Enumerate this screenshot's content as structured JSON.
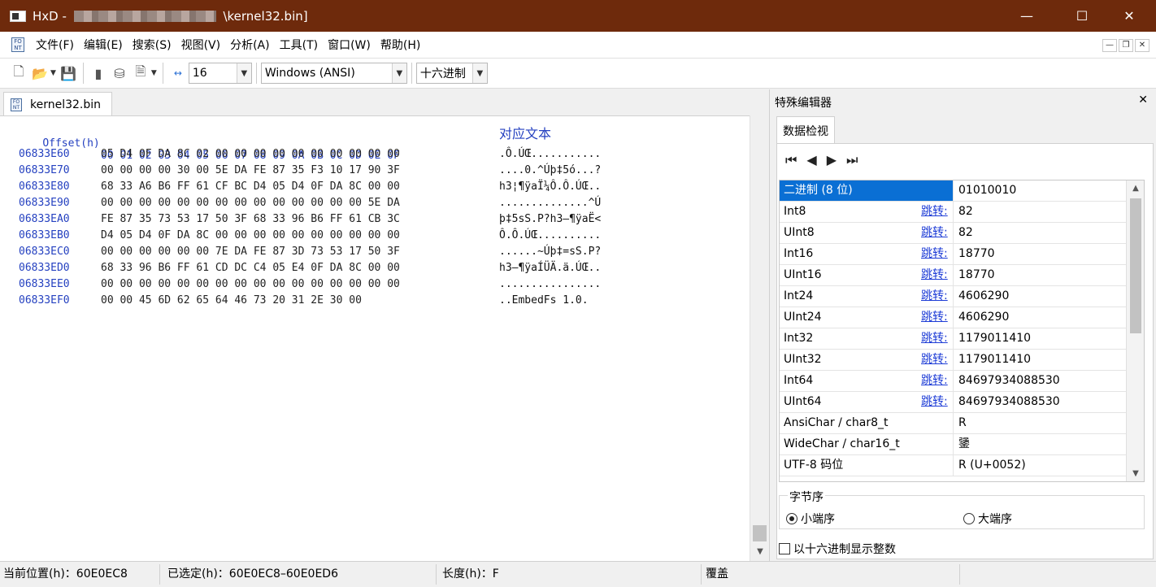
{
  "window": {
    "title_prefix": "HxD -",
    "title_suffix": "\\kernel32.bin]",
    "minimize": "—",
    "maximize": "☐",
    "close": "✕"
  },
  "menu": [
    "文件(F)",
    "编辑(E)",
    "搜索(S)",
    "视图(V)",
    "分析(A)",
    "工具(T)",
    "窗口(W)",
    "帮助(H)"
  ],
  "mdi": {
    "minimize": "—",
    "restore": "❐",
    "close": "✕"
  },
  "toolbar": {
    "bytes_per_row": "16",
    "charset": "Windows (ANSI)",
    "offset_base": "十六进制"
  },
  "editor_tab": {
    "label": "kernel32.bin"
  },
  "hex": {
    "header_offset": "Offset(h)",
    "header_columns": "00 01 02 03 04 05 06 07 08 09 0A 0B 0C 0D 0E 0F",
    "header_text": "对应文本",
    "rows": [
      {
        "off": "06833E60",
        "bytes": "05 D4 0F DA 8C 02 00 00 00 00 00 00 00 00 00 00",
        "ascii": ".Ô.ÚŒ..........."
      },
      {
        "off": "06833E70",
        "bytes": "00 00 00 00 30 00 5E DA FE 87 35 F3 10 17 90 3F",
        "ascii": "....0.^Úþ‡5ó...?"
      },
      {
        "off": "06833E80",
        "bytes": "68 33 A6 B6 FF 61 CF BC D4 05 D4 0F DA 8C 00 00",
        "ascii": "h3¦¶ÿaÏ¼Ô.Ô.ÚŒ.."
      },
      {
        "off": "06833E90",
        "bytes": "00 00 00 00 00 00 00 00 00 00 00 00 00 00 5E DA",
        "ascii": "..............^Ú"
      },
      {
        "off": "06833EA0",
        "bytes": "FE 87 35 73 53 17 50 3F 68 33 96 B6 FF 61 CB 3C",
        "ascii": "þ‡5sS.P?h3–¶ÿaË<"
      },
      {
        "off": "06833EB0",
        "bytes": "D4 05 D4 0F DA 8C 00 00 00 00 00 00 00 00 00 00",
        "ascii": "Ô.Ô.ÚŒ.........."
      },
      {
        "off": "06833EC0",
        "bytes": "00 00 00 00 00 00 7E DA FE 87 3D 73 53 17 50 3F",
        "ascii": "......~Úþ‡=sS.P?"
      },
      {
        "off": "06833ED0",
        "bytes": "68 33 96 B6 FF 61 CD DC C4 05 E4 0F DA 8C 00 00",
        "ascii": "h3–¶ÿaÍÜÄ.ä.ÚŒ.."
      },
      {
        "off": "06833EE0",
        "bytes": "00 00 00 00 00 00 00 00 00 00 00 00 00 00 00 00",
        "ascii": "................"
      },
      {
        "off": "06833EF0",
        "bytes": "00 00 45 6D 62 65 64 46 73 20 31 2E 30 00",
        "ascii": "..EmbedFs 1.0."
      }
    ]
  },
  "panel": {
    "title": "特殊编辑器",
    "close": "✕",
    "tab": "数据检视",
    "jump_label": "跳转:",
    "rows": [
      {
        "name": "二进制 (8 位)",
        "value": "01010010",
        "jump": false
      },
      {
        "name": "Int8",
        "value": "82",
        "jump": true
      },
      {
        "name": "UInt8",
        "value": "82",
        "jump": true
      },
      {
        "name": "Int16",
        "value": "18770",
        "jump": true
      },
      {
        "name": "UInt16",
        "value": "18770",
        "jump": true
      },
      {
        "name": "Int24",
        "value": "4606290",
        "jump": true
      },
      {
        "name": "UInt24",
        "value": "4606290",
        "jump": true
      },
      {
        "name": "Int32",
        "value": "1179011410",
        "jump": true
      },
      {
        "name": "UInt32",
        "value": "1179011410",
        "jump": true
      },
      {
        "name": "Int64",
        "value": "84697934088530",
        "jump": true
      },
      {
        "name": "UInt64",
        "value": "84697934088530",
        "jump": true
      },
      {
        "name": "AnsiChar / char8_t",
        "value": "R",
        "jump": false
      },
      {
        "name": "WideChar / char16_t",
        "value": "䥒",
        "jump": false
      },
      {
        "name": "UTF-8 码位",
        "value": "R (U+0052)",
        "jump": false
      }
    ],
    "byte_order_label": "字节序",
    "little_endian": "小端序",
    "big_endian": "大端序",
    "hex_ints": "以十六进制显示整数"
  },
  "status": {
    "position": "当前位置(h)：60E0EC8",
    "selection": "已选定(h)：60E0EC8–60E0ED6",
    "length": "长度(h)：F",
    "mode": "覆盖"
  }
}
